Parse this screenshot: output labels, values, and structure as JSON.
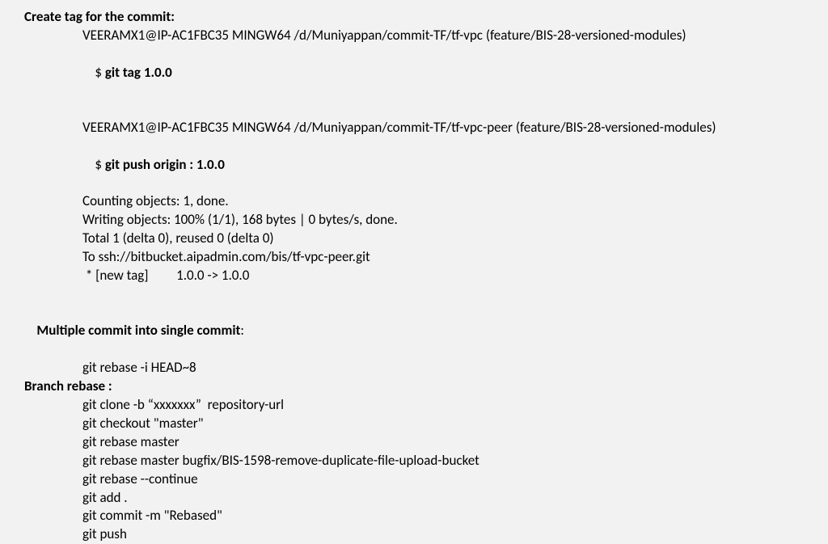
{
  "sec1": {
    "heading": "Create tag for the commit:",
    "line1": "VEERAMX1@IP-AC1FBC35 MINGW64 /d/Muniyappan/commit-TF/tf-vpc (feature/BIS-28-versioned-modules)",
    "prompt1": "$ ",
    "cmd1": "git tag 1.0.0",
    "line2": "VEERAMX1@IP-AC1FBC35 MINGW64 /d/Muniyappan/commit-TF/tf-vpc-peer (feature/BIS-28-versioned-modules)",
    "prompt2": "$ ",
    "cmd2": "git push origin : 1.0.0",
    "out1": "Counting objects: 1, done.",
    "out2": "Writing objects: 100% (1/1), 168 bytes | 0 bytes/s, done.",
    "out3": "Total 1 (delta 0), reused 0 (delta 0)",
    "out4": "To ssh://bitbucket.aipadmin.com/bis/tf-vpc-peer.git",
    "out5": " * [new tag]         1.0.0 -> 1.0.0"
  },
  "sec2": {
    "heading": "Multiple commit into single commit",
    "colon": ":",
    "cmd": "git rebase -i HEAD~8"
  },
  "sec3": {
    "heading": "Branch rebase :",
    "l1": "git clone -b “xxxxxxx”  repository-url",
    "l2": "git checkout \"master\"",
    "l3": "git rebase master",
    "l4": "git rebase master bugfix/BIS-1598-remove-duplicate-file-upload-bucket",
    "l5": "git rebase --continue",
    "l6": "git add .",
    "l7": "git commit -m \"Rebased\"",
    "l8": "git push"
  }
}
